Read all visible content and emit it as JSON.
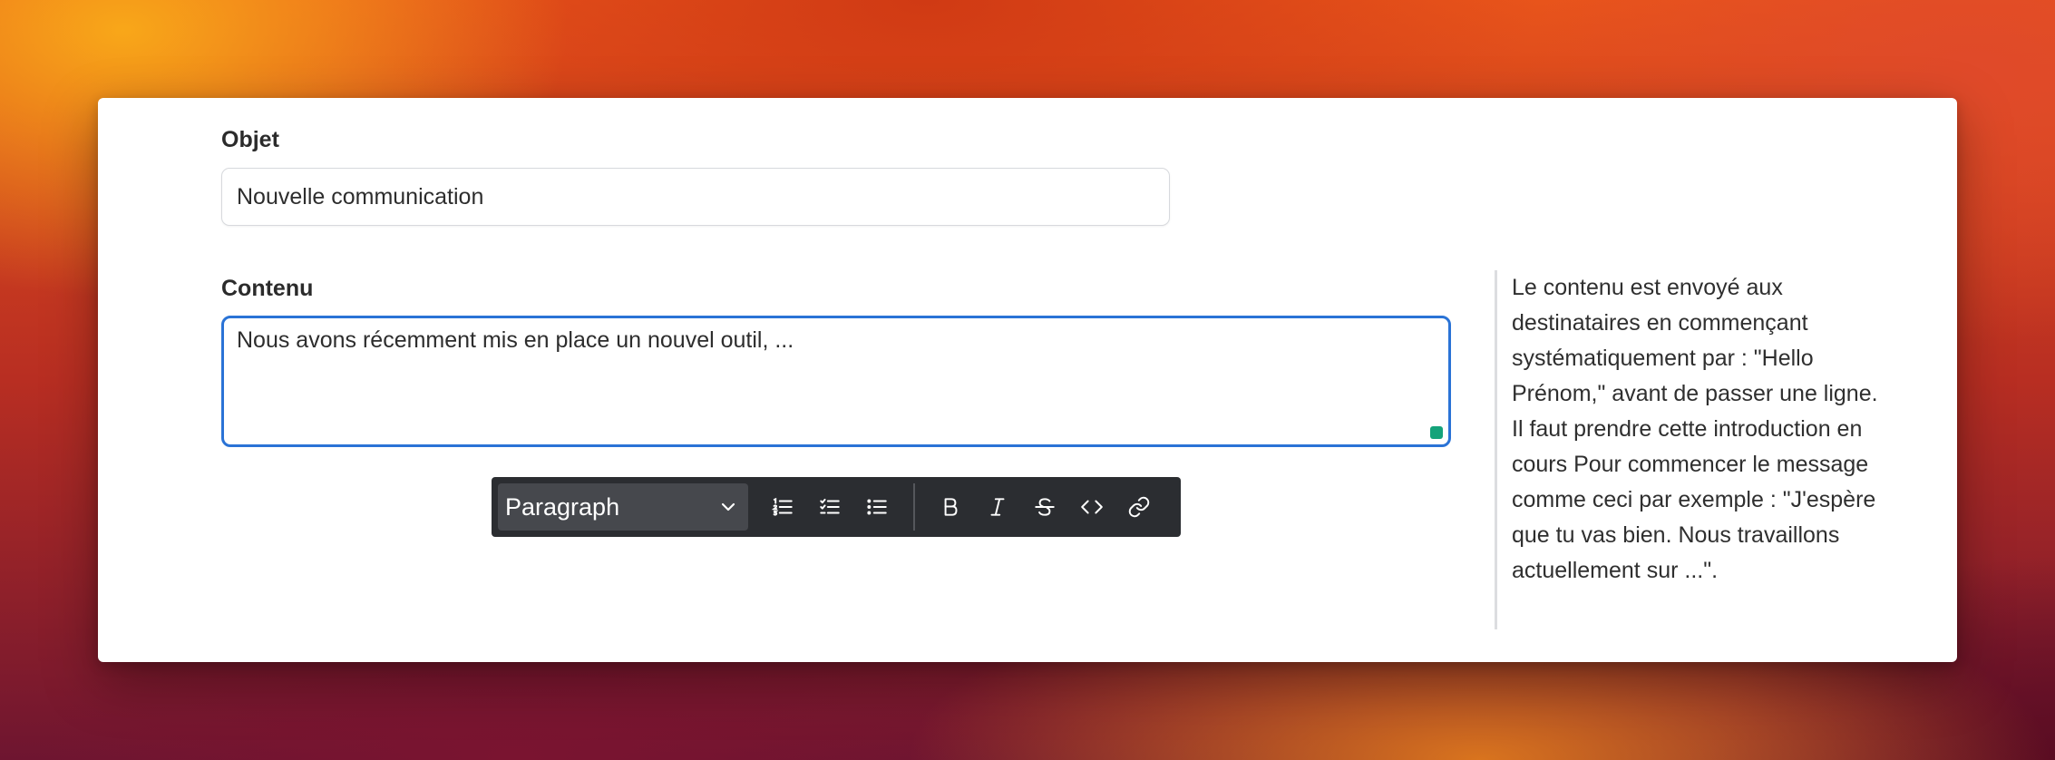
{
  "form": {
    "objet_label": "Objet",
    "objet_value": "Nouvelle communication",
    "contenu_label": "Contenu",
    "contenu_value": "Nous avons récemment mis en place un nouvel outil, ..."
  },
  "toolbar": {
    "block_type": "Paragraph",
    "tools": [
      "ordered-list",
      "checklist",
      "bullet-list",
      "bold",
      "italic",
      "strikethrough",
      "code",
      "link"
    ]
  },
  "help": {
    "text": "Le contenu est envoyé aux destinataires en commençant systématiquement par : \"Hello Prénom,\" avant de passer une ligne. Il faut prendre cette introduction en cours Pour commencer le message comme ceci par exemple : \"J'espère que tu vas bien. Nous travaillons actuellement sur ...\"."
  },
  "colors": {
    "focus_border": "#2a73d6",
    "toolbar_bg": "#2b2d31",
    "grammar_indicator": "#15a37a"
  }
}
